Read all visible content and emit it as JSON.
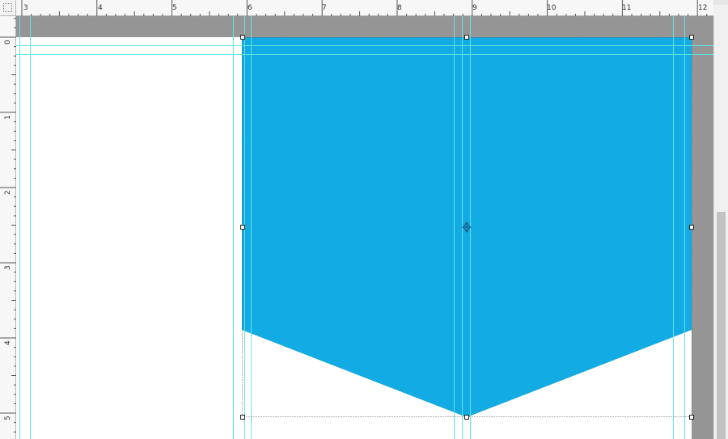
{
  "rulers": {
    "horizontal_labels": [
      "3",
      "4",
      "5",
      "6",
      "7",
      "8",
      "9",
      "10",
      "11",
      "12"
    ],
    "vertical_labels": [
      "0",
      "1",
      "2",
      "3",
      "4",
      "5"
    ]
  },
  "artwork": {
    "banner_color": "#12ABE3",
    "shadow_color": "#F5B11B",
    "page_color": "#FFFFFF",
    "pasteboard_color": "#959595",
    "guide_color": "#5FE6E6",
    "handle_color": "#222222"
  },
  "scrollbar": {
    "position": 0.46,
    "visible_fraction": 0.54
  }
}
